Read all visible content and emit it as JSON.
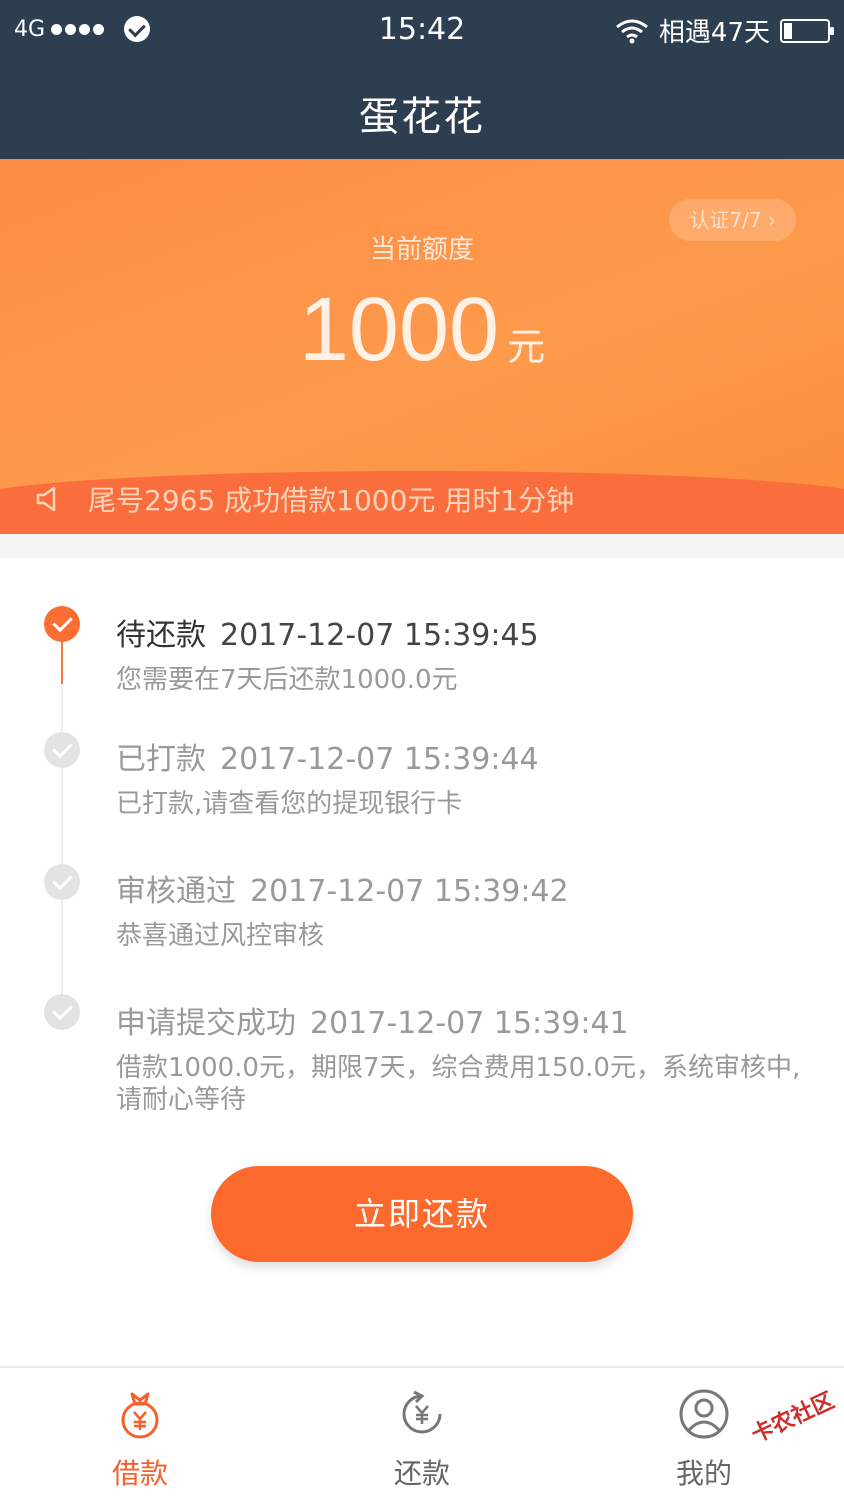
{
  "status_bar": {
    "network": "4G",
    "time": "15:42",
    "carrier_info": "相遇47天"
  },
  "nav": {
    "title": "蛋花花"
  },
  "hero": {
    "cert_badge": "认证7/7",
    "quota_label": "当前额度",
    "quota_value": "1000",
    "quota_unit": "元",
    "notice": "尾号2965 成功借款1000元 用时1分钟"
  },
  "timeline": [
    {
      "title": "待还款",
      "time": "2017-12-07 15:39:45",
      "desc": "您需要在7天后还款1000.0元"
    },
    {
      "title": "已打款",
      "time": "2017-12-07 15:39:44",
      "desc": "已打款,请查看您的提现银行卡"
    },
    {
      "title": "审核通过",
      "time": "2017-12-07 15:39:42",
      "desc": "恭喜通过风控审核"
    },
    {
      "title": "申请提交成功",
      "time": "2017-12-07 15:39:41",
      "desc": "借款1000.0元，期限7天，综合费用150.0元，系统审核中,请耐心等待"
    }
  ],
  "actions": {
    "repay_now": "立即还款"
  },
  "tabbar": {
    "items": [
      {
        "label": "借款",
        "icon": "money-bag-icon"
      },
      {
        "label": "还款",
        "icon": "repay-cycle-icon"
      },
      {
        "label": "我的",
        "icon": "user-icon"
      }
    ],
    "active_color": "#f6602d"
  },
  "watermark": "卡农社区",
  "colors": {
    "nav_bg": "#2c3e50",
    "accent": "#fc6a2e"
  }
}
